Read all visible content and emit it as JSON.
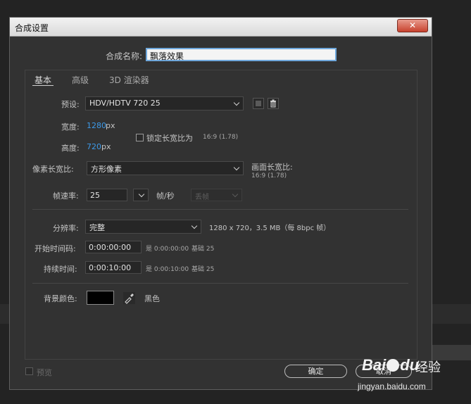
{
  "dialog": {
    "title": "合成设置",
    "close_glyph": "✕"
  },
  "composition_name": {
    "label": "合成名称:",
    "value": "飘落效果"
  },
  "tabs": [
    {
      "label": "基本"
    },
    {
      "label": "高级"
    },
    {
      "label": "3D 渲染器"
    }
  ],
  "preset": {
    "label": "预设:",
    "value": "HDV/HDTV 720 25"
  },
  "width": {
    "label": "宽度:",
    "value": "1280",
    "unit": "px"
  },
  "height": {
    "label": "高度:",
    "value": "720",
    "unit": "px"
  },
  "lock_aspect": {
    "label": "锁定长宽比为",
    "ratio": "16:9 (1.78)",
    "checked": false
  },
  "pixel_aspect": {
    "label": "像素长宽比:",
    "value": "方形像素"
  },
  "frame_aspect": {
    "label": "画面长宽比:",
    "value": "16:9 (1.78)"
  },
  "frame_rate": {
    "label": "帧速率:",
    "value": "25",
    "unit": "帧/秒",
    "drop_frame": "丢帧"
  },
  "resolution": {
    "label": "分辨率:",
    "value": "完整",
    "info": "1280 x 720，3.5 MB（每 8bpc 帧）"
  },
  "start_timecode": {
    "label": "开始时间码:",
    "value": "0:00:00:00",
    "note": "是 0:00:00:00",
    "base": "基础 25"
  },
  "duration": {
    "label": "持续时间:",
    "value": "0:00:10:00",
    "note": "是 0:00:10:00",
    "base": "基础 25"
  },
  "background": {
    "label": "背景颜色:",
    "color_name": "黑色",
    "color": "#000000"
  },
  "preview": {
    "label": "预览"
  },
  "buttons": {
    "ok": "确定",
    "cancel": "取消"
  },
  "watermark": {
    "brand_a": "Bai",
    "brand_b": "du",
    "suffix": "经验",
    "url": "jingyan.baidu.com"
  },
  "colors": {
    "accent_blue": "#3d9ae8",
    "dialog_bg": "#323232",
    "close_red": "#c7422e"
  }
}
